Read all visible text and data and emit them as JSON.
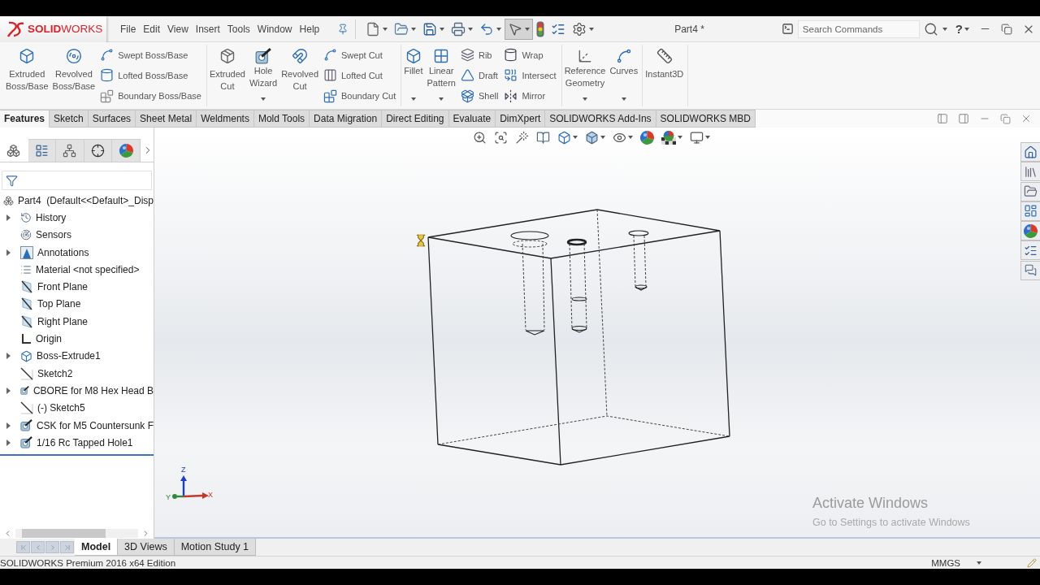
{
  "title_bar": {
    "logo": "**SOLID**WORKS",
    "menus": [
      "File",
      "Edit",
      "View",
      "Insert",
      "Tools",
      "Window",
      "Help"
    ],
    "quick_access": [
      {
        "dropdown": true,
        "pressed": false
      },
      {
        "dropdown": true,
        "pressed": false
      },
      {
        "dropdown": true,
        "pressed": false
      },
      {
        "dropdown": true,
        "pressed": false
      },
      {
        "dropdown": true,
        "pressed": false
      },
      {
        "dropdown": true,
        "pressed": true
      },
      {
        "dropdown": false,
        "pressed": false
      },
      {
        "dropdown": false,
        "pressed": false
      },
      {
        "dropdown": true,
        "pressed": false
      }
    ],
    "document_title": "Part4 *",
    "search": {
      "placeholder": "Search Commands"
    },
    "help": "?"
  },
  "command_manager": {
    "groups": [
      {
        "large": [
          {
            "label": "Extruded Boss/Base",
            "dropdown": false
          },
          {
            "label": "Revolved Boss/Base",
            "dropdown": false
          }
        ],
        "small_columns": [
          [
            "Swept Boss/Base",
            "Lofted Boss/Base",
            "Boundary Boss/Base"
          ]
        ]
      },
      {
        "large": [
          {
            "label": "Extruded Cut",
            "dropdown": false
          },
          {
            "label": "Hole Wizard",
            "dropdown": true
          },
          {
            "label": "Revolved Cut",
            "dropdown": false
          }
        ],
        "small_columns": [
          [
            "Swept Cut",
            "Lofted Cut",
            "Boundary Cut"
          ]
        ]
      },
      {
        "large": [
          {
            "label": "Fillet",
            "dropdown": true
          },
          {
            "label": "Linear Pattern",
            "dropdown": true
          }
        ],
        "small_columns": [
          [
            "Rib",
            "Draft",
            "Shell"
          ],
          [
            "Wrap",
            "Intersect",
            "Mirror"
          ]
        ]
      },
      {
        "large": [
          {
            "label": "Reference Geometry",
            "dropdown": true
          },
          {
            "label": "Curves",
            "dropdown": true
          }
        ]
      },
      {
        "large": [
          {
            "label": "Instant3D",
            "dropdown": false
          }
        ]
      }
    ],
    "tabs": [
      {
        "label": "Features",
        "selected": true
      },
      {
        "label": "Sketch",
        "selected": false
      },
      {
        "label": "Surfaces",
        "selected": false
      },
      {
        "label": "Sheet Metal",
        "selected": false
      },
      {
        "label": "Weldments",
        "selected": false
      },
      {
        "label": "Mold Tools",
        "selected": false
      },
      {
        "label": "Data Migration",
        "selected": false
      },
      {
        "label": "Direct Editing",
        "selected": false
      },
      {
        "label": "Evaluate",
        "selected": false
      },
      {
        "label": "DimXpert",
        "selected": false
      },
      {
        "label": "SOLIDWORKS Add-Ins",
        "selected": false
      },
      {
        "label": "SOLIDWORKS MBD",
        "selected": false
      }
    ]
  },
  "feature_manager": {
    "tabs": [
      {
        "selected": true
      },
      {
        "selected": false
      },
      {
        "selected": false
      },
      {
        "selected": false
      },
      {
        "selected": false
      }
    ],
    "tree": {
      "label": "Part4  (Default<<Default>_Disp",
      "children": [
        {
          "label": "History",
          "kind": "history",
          "expandable": true
        },
        {
          "label": "Sensors",
          "kind": "sensors",
          "expandable": false
        },
        {
          "label": "Annotations",
          "kind": "annotations",
          "expandable": true
        },
        {
          "label": "Material <not specified>",
          "kind": "material",
          "expandable": false
        },
        {
          "label": "Front Plane",
          "kind": "plane",
          "expandable": false
        },
        {
          "label": "Top Plane",
          "kind": "plane",
          "expandable": false
        },
        {
          "label": "Right Plane",
          "kind": "plane",
          "expandable": false
        },
        {
          "label": "Origin",
          "kind": "origin",
          "expandable": false
        },
        {
          "label": "Boss-Extrude1",
          "kind": "extrude",
          "expandable": true
        },
        {
          "label": "Sketch2",
          "kind": "sketch",
          "expandable": false
        },
        {
          "label": "CBORE for M8 Hex Head B",
          "kind": "hole",
          "expandable": true
        },
        {
          "label": "(-) Sketch5",
          "kind": "sketch",
          "expandable": false
        },
        {
          "label": "CSK for M5 Countersunk F",
          "kind": "hole",
          "expandable": true
        },
        {
          "label": "1/16 Rc Tapped Hole1",
          "kind": "hole",
          "expandable": true
        }
      ]
    }
  },
  "graphics": {
    "view_toolbar": [
      {
        "dropdown": false
      },
      {
        "dropdown": false
      },
      {
        "dropdown": false
      },
      {
        "dropdown": false
      },
      {
        "dropdown": true
      },
      {
        "dropdown": true
      },
      {
        "dropdown": true
      },
      {
        "dropdown": false
      },
      {
        "dropdown": true
      },
      {
        "dropdown": true
      }
    ],
    "triad": {
      "x": "X",
      "y": "Y",
      "z": "Z"
    },
    "watermark": {
      "title": "Activate Windows",
      "text": "Go to Settings to activate Windows"
    }
  },
  "bottom_tabs": [
    {
      "label": "Model",
      "selected": true
    },
    {
      "label": "3D Views",
      "selected": false
    },
    {
      "label": "Motion Study 1",
      "selected": false
    }
  ],
  "status_bar": {
    "edition": "SOLIDWORKS Premium 2016 x64 Edition",
    "units": "MMGS"
  }
}
